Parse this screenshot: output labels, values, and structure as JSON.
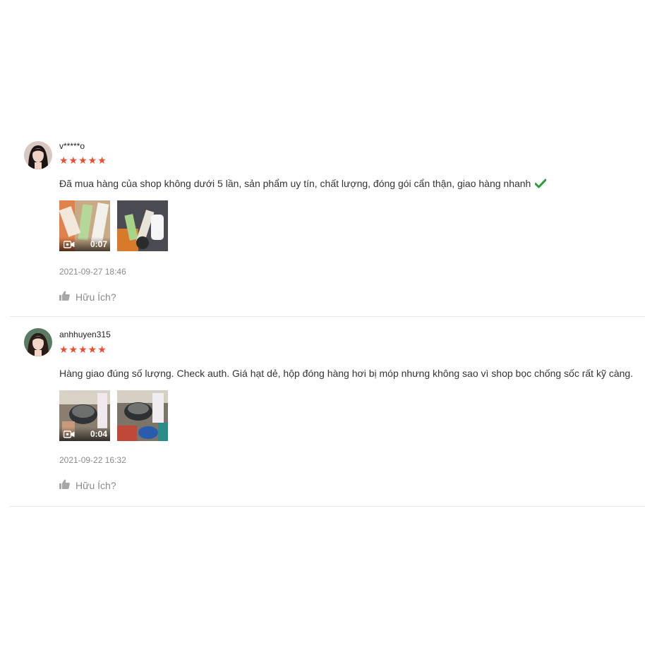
{
  "reviews": [
    {
      "username": "v*****o",
      "stars": "★★★★★",
      "rating": 5,
      "comment": "Đã mua hàng của shop không dưới 5 lần, sản phẩm uy tín, chất lượng, đóng gói cẩn thận, giao hàng nhanh",
      "video_duration": "0:07",
      "date": "2021-09-27 18:46",
      "helpful_label": "Hữu Ích?"
    },
    {
      "username": "anhhuyen315",
      "stars": "★★★★★",
      "rating": 5,
      "comment": "Hàng giao đúng số lượng. Check auth. Giá hạt dẻ, hộp đóng hàng hơi bị móp nhưng không sao vì shop bọc chống sốc rất kỹ càng.",
      "video_duration": "0:04",
      "date": "2021-09-22 16:32",
      "helpful_label": "Hữu Ích?"
    }
  ],
  "colors": {
    "star": "#ee4d2d",
    "check": "#2e9b3a",
    "muted": "#8a8a8a"
  }
}
